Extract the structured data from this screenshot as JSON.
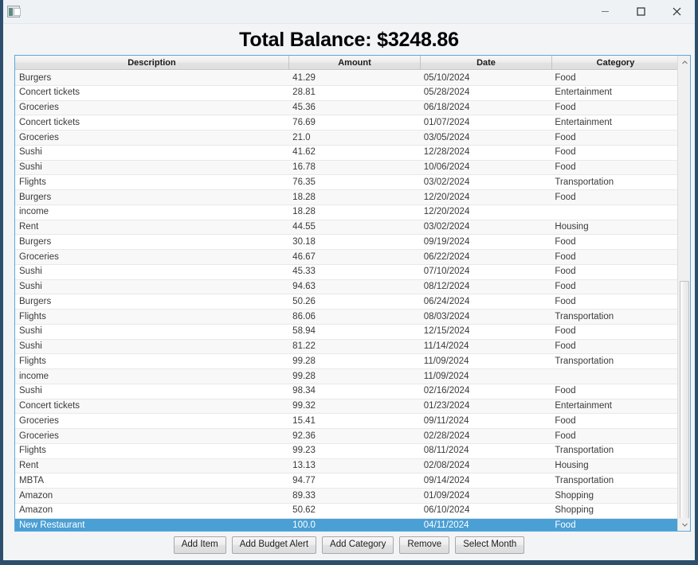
{
  "window": {
    "app_icon": "app-window-icon",
    "controls": {
      "minimize": "minimize-icon",
      "maximize": "maximize-icon",
      "close": "close-icon"
    }
  },
  "header": {
    "title": "Total Balance: $3248.86"
  },
  "table": {
    "columns": [
      "Description",
      "Amount",
      "Date",
      "Category"
    ],
    "rows": [
      {
        "description": "Burgers",
        "amount": "41.29",
        "date": "05/10/2024",
        "category": "Food",
        "selected": false
      },
      {
        "description": "Concert tickets",
        "amount": "28.81",
        "date": "05/28/2024",
        "category": "Entertainment",
        "selected": false
      },
      {
        "description": "Groceries",
        "amount": "45.36",
        "date": "06/18/2024",
        "category": "Food",
        "selected": false
      },
      {
        "description": "Concert tickets",
        "amount": "76.69",
        "date": "01/07/2024",
        "category": "Entertainment",
        "selected": false
      },
      {
        "description": "Groceries",
        "amount": "21.0",
        "date": "03/05/2024",
        "category": "Food",
        "selected": false
      },
      {
        "description": "Sushi",
        "amount": "41.62",
        "date": "12/28/2024",
        "category": "Food",
        "selected": false
      },
      {
        "description": "Sushi",
        "amount": "16.78",
        "date": "10/06/2024",
        "category": "Food",
        "selected": false
      },
      {
        "description": "Flights",
        "amount": "76.35",
        "date": "03/02/2024",
        "category": "Transportation",
        "selected": false
      },
      {
        "description": "Burgers",
        "amount": "18.28",
        "date": "12/20/2024",
        "category": "Food",
        "selected": false
      },
      {
        "description": "income",
        "amount": "18.28",
        "date": "12/20/2024",
        "category": "",
        "selected": false
      },
      {
        "description": "Rent",
        "amount": "44.55",
        "date": "03/02/2024",
        "category": "Housing",
        "selected": false
      },
      {
        "description": "Burgers",
        "amount": "30.18",
        "date": "09/19/2024",
        "category": "Food",
        "selected": false
      },
      {
        "description": "Groceries",
        "amount": "46.67",
        "date": "06/22/2024",
        "category": "Food",
        "selected": false
      },
      {
        "description": "Sushi",
        "amount": "45.33",
        "date": "07/10/2024",
        "category": "Food",
        "selected": false
      },
      {
        "description": "Sushi",
        "amount": "94.63",
        "date": "08/12/2024",
        "category": "Food",
        "selected": false
      },
      {
        "description": "Burgers",
        "amount": "50.26",
        "date": "06/24/2024",
        "category": "Food",
        "selected": false
      },
      {
        "description": "Flights",
        "amount": "86.06",
        "date": "08/03/2024",
        "category": "Transportation",
        "selected": false
      },
      {
        "description": "Sushi",
        "amount": "58.94",
        "date": "12/15/2024",
        "category": "Food",
        "selected": false
      },
      {
        "description": "Sushi",
        "amount": "81.22",
        "date": "11/14/2024",
        "category": "Food",
        "selected": false
      },
      {
        "description": "Flights",
        "amount": "99.28",
        "date": "11/09/2024",
        "category": "Transportation",
        "selected": false
      },
      {
        "description": "income",
        "amount": "99.28",
        "date": "11/09/2024",
        "category": "",
        "selected": false
      },
      {
        "description": "Sushi",
        "amount": "98.34",
        "date": "02/16/2024",
        "category": "Food",
        "selected": false
      },
      {
        "description": "Concert tickets",
        "amount": "99.32",
        "date": "01/23/2024",
        "category": "Entertainment",
        "selected": false
      },
      {
        "description": "Groceries",
        "amount": "15.41",
        "date": "09/11/2024",
        "category": "Food",
        "selected": false
      },
      {
        "description": "Groceries",
        "amount": "92.36",
        "date": "02/28/2024",
        "category": "Food",
        "selected": false
      },
      {
        "description": "Flights",
        "amount": "99.23",
        "date": "08/11/2024",
        "category": "Transportation",
        "selected": false
      },
      {
        "description": "Rent",
        "amount": "13.13",
        "date": "02/08/2024",
        "category": "Housing",
        "selected": false
      },
      {
        "description": "MBTA",
        "amount": "94.77",
        "date": "09/14/2024",
        "category": "Transportation",
        "selected": false
      },
      {
        "description": "Amazon",
        "amount": "89.33",
        "date": "01/09/2024",
        "category": "Shopping",
        "selected": false
      },
      {
        "description": "Amazon",
        "amount": "50.62",
        "date": "06/10/2024",
        "category": "Shopping",
        "selected": false
      },
      {
        "description": "New Restaurant",
        "amount": "100.0",
        "date": "04/11/2024",
        "category": "Food",
        "selected": true
      }
    ]
  },
  "scrollbar": {
    "up_arrow": "chevron-up-icon",
    "down_arrow": "chevron-down-icon"
  },
  "buttons": [
    {
      "label": "Add Item",
      "name": "add-item-button"
    },
    {
      "label": "Add Budget Alert",
      "name": "add-budget-alert-button"
    },
    {
      "label": "Add Category",
      "name": "add-category-button"
    },
    {
      "label": "Remove",
      "name": "remove-button"
    },
    {
      "label": "Select Month",
      "name": "select-month-button"
    }
  ],
  "colors": {
    "window_border": "#2c4f6e",
    "table_border": "#5aa9dd",
    "selection": "#4a9fd4",
    "titlebar_bg": "#eef2f5",
    "body_bg": "#f2f4f5"
  }
}
